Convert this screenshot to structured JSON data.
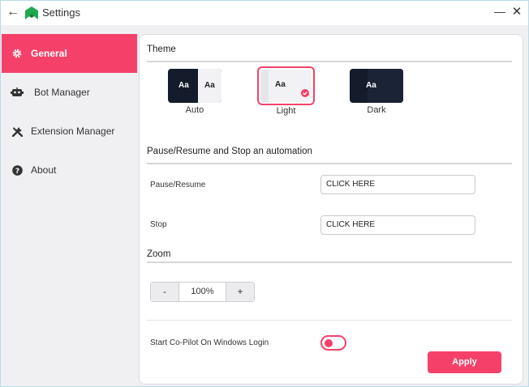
{
  "window": {
    "title": "Settings",
    "back_glyph": "←",
    "minimize_glyph": "—",
    "close_glyph": "✕"
  },
  "colors": {
    "accent": "#f5416a",
    "logo_green": "#1fa84f",
    "dark_card": "#141b2b"
  },
  "sidebar": {
    "items": [
      {
        "label": "General",
        "icon": "gear-icon",
        "active": true
      },
      {
        "label": "Bot Manager",
        "icon": "robot-icon",
        "active": false
      },
      {
        "label": "Extension Manager",
        "icon": "tools-icon",
        "active": false
      },
      {
        "label": "About",
        "icon": "help-circle-icon",
        "active": false
      }
    ]
  },
  "theme": {
    "title": "Theme",
    "sample_text": "Aa",
    "options": [
      {
        "label": "Auto",
        "selected": false
      },
      {
        "label": "Light",
        "selected": true
      },
      {
        "label": "Dark",
        "selected": false
      }
    ]
  },
  "automation": {
    "title": "Pause/Resume and Stop an automation",
    "rows": [
      {
        "label": "Pause/Resume",
        "value": "CLICK HERE"
      },
      {
        "label": "Stop",
        "value": "CLICK HERE"
      }
    ]
  },
  "zoom": {
    "title": "Zoom",
    "minus": "-",
    "value": "100%",
    "plus": "+"
  },
  "startup": {
    "label": "Start Co-Pilot On Windows Login",
    "enabled": true
  },
  "apply_label": "Apply"
}
